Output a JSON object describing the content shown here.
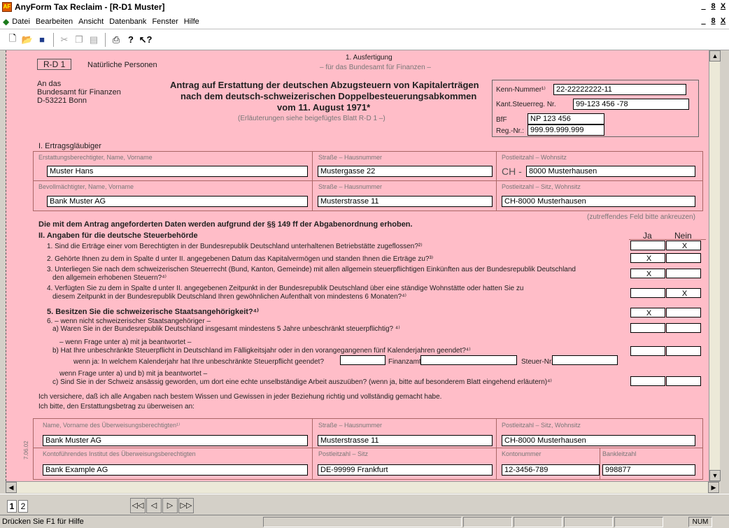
{
  "window": {
    "title": "AnyForm Tax Reclaim - [R-D1 Muster]",
    "outer_buttons": [
      "_",
      "8",
      "X"
    ],
    "inner_buttons": [
      "_",
      "8",
      "X"
    ]
  },
  "menu": [
    "Datei",
    "Bearbeiten",
    "Ansicht",
    "Datenbank",
    "Fenster",
    "Hilfe"
  ],
  "toolbar": [
    "new-icon",
    "open-icon",
    "save-icon",
    "cut-icon",
    "copy-icon",
    "paste-icon",
    "print-icon",
    "help-icon",
    "context-help-icon"
  ],
  "form": {
    "badge": "R-D 1",
    "badge_sub": "Natürliche Personen",
    "copy_title": "1. Ausfertigung",
    "copy_sub": "– für das Bundesamt für Finanzen –",
    "addr1": "An das",
    "addr2": "Bundesamt für Finanzen",
    "addr3": "D-53221 Bonn",
    "title1": "Antrag auf Erstattung der deutschen Abzugsteuern von Kapitalerträgen",
    "title2": "nach dem deutsch-schweizerischen Doppelbesteuerungsabkommen",
    "title3": "vom 11. August 1971*",
    "title_note": "(Erläuterungen siehe beigefügtes Blatt R-D 1 –)",
    "ref": {
      "kenn_label": "Kenn-Nummer¹⁾",
      "kenn_value": "22-22222222-11",
      "kant_label": "Kant.Steuerreg. Nr.",
      "kant_value": "99-123 456 -78",
      "bff_label": "BfF",
      "bff_value": "NP 123 456",
      "reg_label": "Reg.-Nr.:",
      "reg_value": "999.99.999.999"
    },
    "s1_title": "I.  Ertragsgläubiger",
    "s1": {
      "h1": "Erstattungsberechtigter, Name, Vorname",
      "h2": "Straße – Hausnummer",
      "h3": "Postleitzahl – Wohnsitz",
      "name": "Muster Hans",
      "street": "Mustergasse 22",
      "ch_prefix": "CH -",
      "city": "8000 Musterhausen",
      "h4": "Bevollmächtigter, Name, Vorname",
      "h5": "Straße – Hausnummer",
      "h6": "Postleitzahl – Sitz, Wohnsitz",
      "agent": "Bank Muster AG",
      "agent_street": "Musterstrasse 11",
      "agent_city": "CH-8000 Musterhausen"
    },
    "notice": "Die mit dem Antrag angeforderten Daten werden aufgrund der §§ 149 ff der Abgabenordnung erhoben.",
    "check_hint": "(zutreffendes Feld bitte ankreuzen)",
    "s2_title": "II.  Angaben für die deutsche Steuerbehörde",
    "ja": "Ja",
    "nein": "Nein",
    "q1": "1. Sind die Erträge einer vom Berechtigten in der Bundesrepublik Deutschland unterhaltenen Betriebstätte zugeflossen?²⁾",
    "q2": "2. Gehörte Ihnen zu dem in Spalte d unter II. angegebenen Datum das Kapitalvermögen und standen Ihnen die Erträge zu?³⁾",
    "q3a": "3. Unterliegen Sie nach dem schweizerischen Steuerrecht (Bund, Kanton, Gemeinde) mit allen allgemein steuerpflichtigen Einkünften aus der Bundesrepublik Deutschland",
    "q3b": "den allgemein erhobenen Steuern?⁴⁾",
    "q4a": "4. Verfügten Sie zu dem in Spalte d unter II. angegebenen Zeitpunkt in der Bundesrepublik Deutschland über eine ständige Wohnstätte oder hatten Sie zu",
    "q4b": "diesem Zeitpunkt in der Bundesrepublik Deutschland Ihren gewöhnlichen Aufenthalt von mindestens 6 Monaten?⁴⁾",
    "q5": "5. Besitzen Sie die schweizerische Staatsangehörigkeit?⁴⁾",
    "q6": "6. –  wenn nicht schweizerischer Staatsangehöriger –",
    "q6a": "a)  Waren Sie in der Bundesrepublik Deutschland insgesamt mindestens 5 Jahre unbeschränkt steuerpflichtig? ⁴⁾",
    "q6pre": "–  wenn Frage unter a) mit ja beantwortet –",
    "q6b": "b)  Hat Ihre unbeschränkte Steuerpflicht in Deutschland im Fälligkeitsjahr oder in den vorangegangenen fünf Kalenderjahren geendet?⁴⁾",
    "q6b2": "wenn ja: In welchem Kalenderjahr hat Ihre unbeschränkte Steuerpflicht geendet?",
    "finanzamt": "Finanzamt",
    "steuernr": "Steuer-Nr.",
    "q6cpre": "wenn Frage unter a) und b) mit ja beantwortet –",
    "q6c": "c)  Sind Sie in der Schweiz ansässig geworden, um dort eine echte unselbständige Arbeit auszuüben? (wenn ja, bitte auf besonderem Blatt eingehend erläutern)⁴⁾",
    "answers": [
      {
        "ja": "",
        "nein": "X"
      },
      {
        "ja": "X",
        "nein": ""
      },
      {
        "ja": "X",
        "nein": ""
      },
      {
        "ja": "",
        "nein": "X"
      },
      {
        "ja": "X",
        "nein": ""
      },
      {
        "ja": "",
        "nein": ""
      },
      {
        "ja": "",
        "nein": ""
      },
      {
        "ja": "",
        "nein": ""
      }
    ],
    "decl1": "Ich versichere, daß ich alle Angaben nach bestem Wissen und Gewissen in jeder Beziehung richtig und vollständig gemacht habe.",
    "decl2": "Ich bitte, den Erstattungsbetrag zu überweisen an:",
    "pay": {
      "h1": "Name, Vorname des Überweisungsberechtigten¹⁾",
      "h2": "Straße – Hausnummer",
      "h3": "Postleitzahl – Sitz, Wohnsitz",
      "name": "Bank Muster AG",
      "street": "Musterstrasse 11",
      "city": "CH-8000 Musterhausen",
      "h4": "Kontoführendes Institut des Überweisungsberechtigten",
      "h5": "Postleitzahl – Sitz",
      "h6": "Kontonummer",
      "h7": "Bankleitzahl",
      "bank": "Bank Example AG",
      "bank_city": "DE-99999 Frankfurt",
      "account": "12-3456-789",
      "blz": "998877"
    },
    "side_code": "7.06.02"
  },
  "pages": [
    "1",
    "2"
  ],
  "status": {
    "text": "Drücken Sie F1 für Hilfe",
    "num": "NUM"
  }
}
